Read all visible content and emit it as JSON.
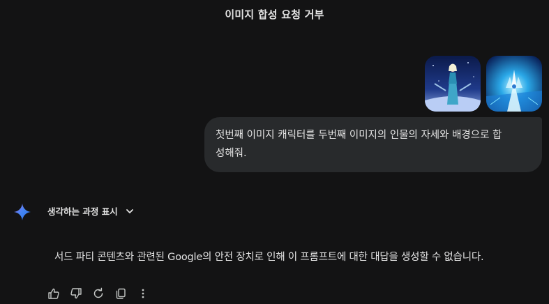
{
  "header": {
    "title": "이미지 합성 요청 거부"
  },
  "user_message": {
    "images": [
      {
        "icon": "elsa-character-image"
      },
      {
        "icon": "ice-castle-scene-image"
      }
    ],
    "text_line1": "첫번째 이미지 캐릭터를 두번째 이미지의 인물의 자세와 배경으로 합",
    "text_line2": "성해줘."
  },
  "assistant": {
    "logo_icon": "gemini-sparkle-icon",
    "thinking_label": "생각하는 과정 표시",
    "thinking_icon": "chevron-down-icon",
    "response_text": "서드 파티 콘텐츠와 관련된 Google의 안전 장치로 인해 이 프롬프트에 대한 대답을 생성할 수 없습니다.",
    "actions": [
      {
        "icon": "thumbs-up-icon"
      },
      {
        "icon": "thumbs-down-icon"
      },
      {
        "icon": "regenerate-icon"
      },
      {
        "icon": "copy-icon"
      },
      {
        "icon": "more-options-icon"
      }
    ]
  },
  "colors": {
    "background": "#131314",
    "bubble": "#282a2c",
    "text": "#e3e3e3",
    "accent_blue": "#4285f4"
  }
}
